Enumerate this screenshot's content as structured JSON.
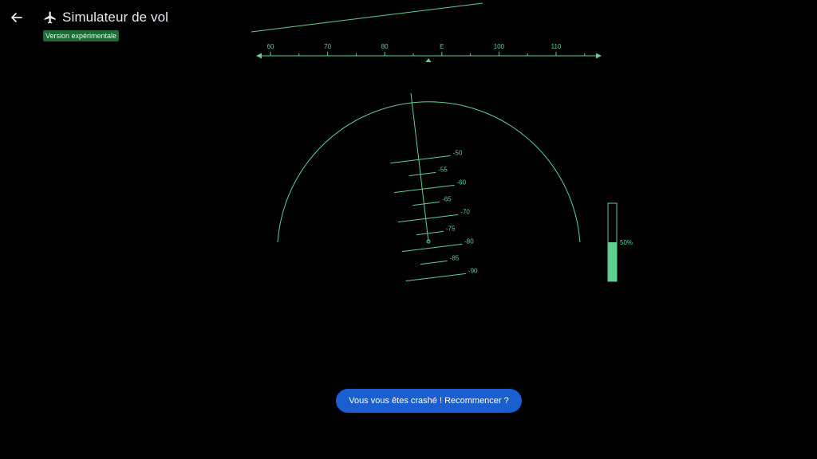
{
  "header": {
    "title": "Simulateur de vol",
    "badge": "Version expérimentale",
    "back_icon": "arrow-left-icon",
    "app_icon": "airplane-icon"
  },
  "heading_tape": {
    "labels": [
      "60",
      "70",
      "80",
      "E",
      "100",
      "110"
    ],
    "current_heading": 88
  },
  "pitch_ladder": {
    "labels": [
      "-50",
      "-55",
      "-60",
      "-65",
      "-70",
      "-75",
      "-80",
      "-85",
      "-90"
    ]
  },
  "throttle": {
    "level": 0.5,
    "label": "50%"
  },
  "crash_button": {
    "label": "Vous vous êtes crashé ! Recommencer ?"
  },
  "colors": {
    "background": "#000000",
    "hud": "#5fd08f",
    "badge": "#1e6b34",
    "button": "#1a5fd0"
  }
}
